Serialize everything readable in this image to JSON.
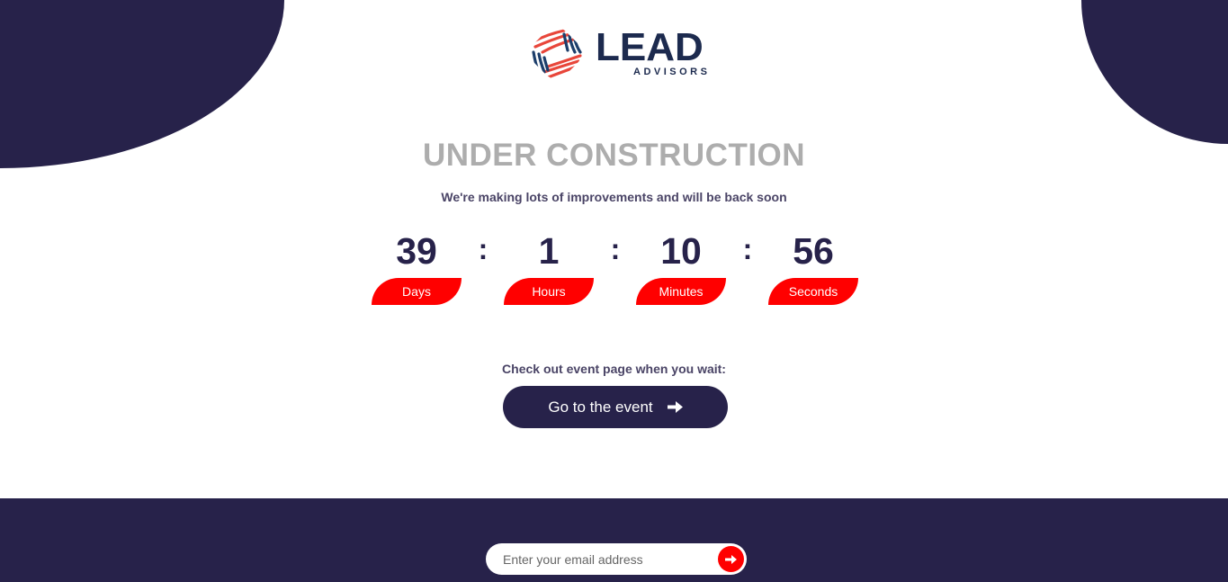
{
  "brand": {
    "name": "LEAD",
    "tagline": "ADVISORS",
    "colors": {
      "navy": "#27224a",
      "red": "#ff0000",
      "title_gray": "#adadad"
    },
    "logo_icon": "lead-advisors-logo-mark"
  },
  "hero": {
    "title": "UNDER CONSTRUCTION",
    "subtitle": "We're making lots of improvements and will be back soon"
  },
  "countdown": {
    "days": {
      "value": "39",
      "label": "Days"
    },
    "hours": {
      "value": "1",
      "label": "Hours"
    },
    "minutes": {
      "value": "10",
      "label": "Minutes"
    },
    "seconds": {
      "value": "56",
      "label": "Seconds"
    },
    "separator": ":"
  },
  "cta": {
    "text": "Check out event page when you wait:",
    "button_label": "Go to the event",
    "button_icon": "arrow-right-icon"
  },
  "footer": {
    "email_placeholder": "Enter your email address",
    "submit_icon": "arrow-right-icon"
  }
}
